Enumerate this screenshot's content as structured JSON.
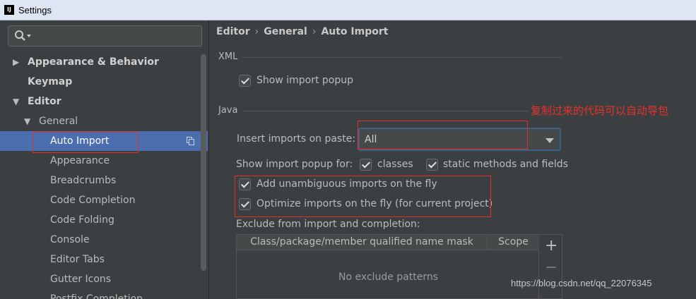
{
  "window": {
    "title": "Settings"
  },
  "sidebar": {
    "search": {
      "placeholder": ""
    },
    "items": [
      {
        "label": "Appearance & Behavior",
        "arrow": "▶"
      },
      {
        "label": "Keymap"
      },
      {
        "label": "Editor",
        "arrow": "▼"
      },
      {
        "label": "General",
        "arrow": "▼"
      },
      {
        "label": "Auto Import"
      },
      {
        "label": "Appearance"
      },
      {
        "label": "Breadcrumbs"
      },
      {
        "label": "Code Completion"
      },
      {
        "label": "Code Folding"
      },
      {
        "label": "Console"
      },
      {
        "label": "Editor Tabs"
      },
      {
        "label": "Gutter Icons"
      },
      {
        "label": "Postfix Completion"
      }
    ]
  },
  "breadcrumb": {
    "part1": "Editor",
    "part2": "General",
    "part3": "Auto Import",
    "separator": "›"
  },
  "xml": {
    "title": "XML",
    "show_import_popup": {
      "label": "Show import popup",
      "checked": true
    }
  },
  "java": {
    "title": "Java",
    "insert_imports_label": "Insert imports on paste:",
    "insert_imports_value": "All",
    "show_popup_for_label": "Show import popup for:",
    "classes": {
      "label": "classes",
      "checked": true
    },
    "static_members": {
      "label": "static methods and fields",
      "checked": true
    },
    "add_unambiguous": {
      "label": "Add unambiguous imports on the fly",
      "checked": true
    },
    "optimize_imports": {
      "label": "Optimize imports on the fly (for current project)",
      "checked": true
    },
    "exclude_label": "Exclude from import and completion:",
    "table": {
      "columns": [
        "Class/package/member qualified name mask",
        "Scope"
      ],
      "empty_text": "No exclude patterns"
    },
    "add_button": "+",
    "remove_button": "−"
  },
  "annotation": "复制过来的代码可以自动导包",
  "watermark": "https://blog.csdn.net/qq_22076345",
  "colors": {
    "background": "#3c3f41",
    "selection": "#4b6eaf",
    "annotation_red": "#e8312a",
    "titlebar": "#dde6f2"
  },
  "icons": {
    "search": "magnifier-icon",
    "copy": "copy-icon",
    "expand": "triangle-right-icon",
    "collapse": "triangle-down-icon",
    "dropdown": "chevron-down-icon"
  }
}
